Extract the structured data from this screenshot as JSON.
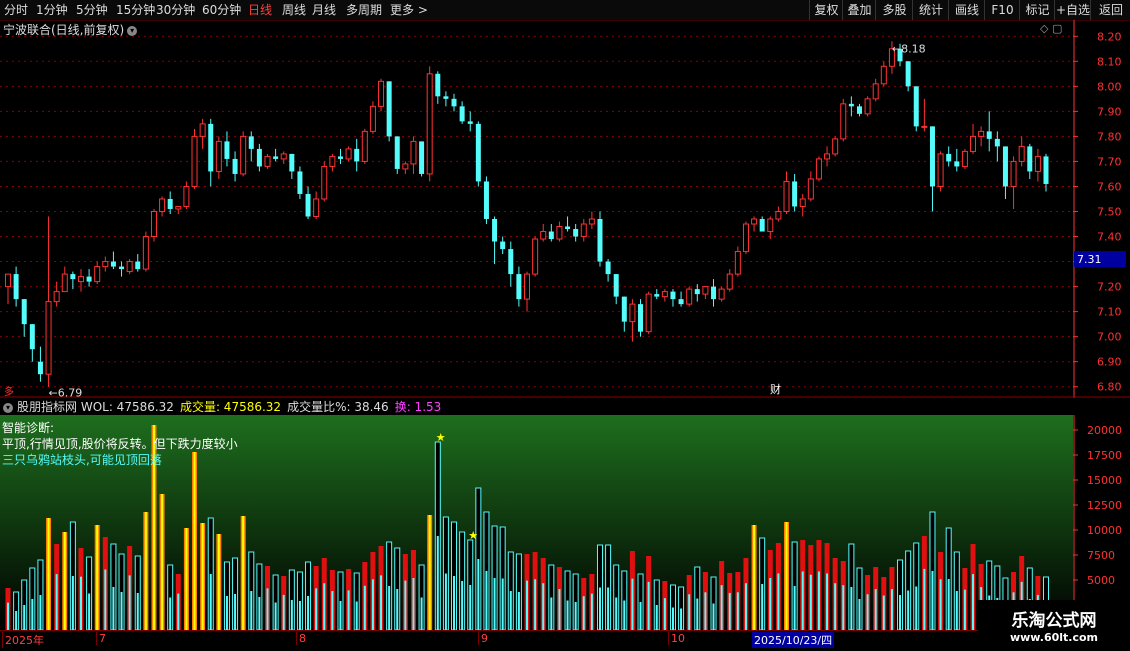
{
  "toolbar": {
    "periods": [
      {
        "label": "分时",
        "active": false
      },
      {
        "label": "1分钟",
        "active": false
      },
      {
        "label": "5分钟",
        "active": false
      },
      {
        "label": "15分钟",
        "active": false
      },
      {
        "label": "30分钟",
        "active": false
      },
      {
        "label": "60分钟",
        "active": false
      },
      {
        "label": "日线",
        "active": true
      },
      {
        "label": "周线",
        "active": false
      },
      {
        "label": "月线",
        "active": false
      },
      {
        "label": "多周期",
        "active": false
      },
      {
        "label": "更多 >",
        "active": false
      }
    ],
    "right_buttons": [
      "复权",
      "叠加",
      "多股",
      "统计",
      "画线",
      "F10",
      "标记",
      "+自选",
      "返回"
    ]
  },
  "chart_header": {
    "title": "宁波联合(日线,前复权)"
  },
  "colors": {
    "up": "#ff3232",
    "down": "#54fcfc",
    "grid": "#8b0000",
    "axis": "#ff3232",
    "yellow": "#ffff00",
    "volume_bg_top": "#000000",
    "volume_bg_bottom": "#1e6e1e"
  },
  "price_axis": {
    "ticks": [
      "8.20",
      "8.10",
      "8.00",
      "7.90",
      "7.80",
      "7.70",
      "7.60",
      "7.50",
      "7.40",
      "7.30",
      "7.20",
      "7.10",
      "7.00",
      "6.90",
      "6.80"
    ],
    "current_price": "7.31",
    "high_label": "8.18",
    "low_label": "6.79"
  },
  "markers": {
    "finance": "财",
    "corner": "多"
  },
  "indicator": {
    "name": "股朋指标网",
    "items": [
      {
        "label": "WOL:",
        "value": "47586.32",
        "color": "#dddddd"
      },
      {
        "label": "成交量:",
        "value": "47586.32",
        "color": "#ffff00"
      },
      {
        "label": "成交量比%:",
        "value": "38.46",
        "color": "#dddddd"
      },
      {
        "label": "换:",
        "value": "1.53",
        "color": "#ff40ff"
      }
    ],
    "diagnosis": {
      "title": "智能诊断:",
      "line1": "平顶,行情见顶,股价将反转。但下跌力度较小",
      "line2": "三只乌鸦站枝头,可能见顶回落"
    },
    "axis_ticks": [
      "20000",
      "17500",
      "15000",
      "12500",
      "10000",
      "7500",
      "5000"
    ]
  },
  "time_axis": {
    "labels": [
      "2025年",
      "7",
      "8",
      "9",
      "10",
      "2025/10/23/四"
    ]
  },
  "watermark": {
    "line1": "乐淘公式网",
    "line2": "www.60lt.com"
  },
  "chart_data": {
    "type": "candlestick",
    "y_range": [
      6.79,
      8.18
    ],
    "vol_range": [
      0,
      21000
    ],
    "candles": [
      [
        7.2,
        7.25,
        7.13,
        7.25,
        4200
      ],
      [
        7.25,
        7.28,
        7.12,
        7.15,
        3800
      ],
      [
        7.15,
        7.15,
        7.0,
        7.05,
        5000
      ],
      [
        7.05,
        7.05,
        6.9,
        6.95,
        6200
      ],
      [
        6.9,
        6.96,
        6.82,
        6.85,
        7000
      ],
      [
        6.85,
        7.48,
        6.8,
        7.14,
        11200
      ],
      [
        7.14,
        7.22,
        7.12,
        7.18,
        8600
      ],
      [
        7.18,
        7.28,
        7.18,
        7.25,
        9800
      ],
      [
        7.25,
        7.26,
        7.19,
        7.23,
        10800
      ],
      [
        7.22,
        7.27,
        7.18,
        7.24,
        8200
      ],
      [
        7.24,
        7.27,
        7.2,
        7.22,
        7300
      ],
      [
        7.22,
        7.3,
        7.21,
        7.28,
        10500
      ],
      [
        7.28,
        7.32,
        7.26,
        7.3,
        9300
      ],
      [
        7.3,
        7.34,
        7.27,
        7.28,
        8600
      ],
      [
        7.28,
        7.3,
        7.24,
        7.27,
        7600
      ],
      [
        7.26,
        7.31,
        7.25,
        7.3,
        8400
      ],
      [
        7.3,
        7.33,
        7.26,
        7.27,
        7400
      ],
      [
        7.27,
        7.42,
        7.26,
        7.4,
        11800
      ],
      [
        7.4,
        7.51,
        7.38,
        7.5,
        20500
      ],
      [
        7.5,
        7.56,
        7.48,
        7.55,
        13600
      ],
      [
        7.55,
        7.58,
        7.49,
        7.51,
        6500
      ],
      [
        7.51,
        7.52,
        7.49,
        7.52,
        5600
      ],
      [
        7.52,
        7.62,
        7.51,
        7.6,
        10200
      ],
      [
        7.6,
        7.83,
        7.59,
        7.8,
        17800
      ],
      [
        7.8,
        7.87,
        7.75,
        7.85,
        10700
      ],
      [
        7.85,
        7.87,
        7.6,
        7.66,
        11200
      ],
      [
        7.66,
        7.8,
        7.63,
        7.78,
        9600
      ],
      [
        7.78,
        7.82,
        7.68,
        7.71,
        6800
      ],
      [
        7.71,
        7.74,
        7.62,
        7.65,
        7200
      ],
      [
        7.65,
        7.82,
        7.64,
        7.8,
        11400
      ],
      [
        7.8,
        7.82,
        7.7,
        7.75,
        7800
      ],
      [
        7.75,
        7.77,
        7.66,
        7.68,
        6600
      ],
      [
        7.68,
        7.73,
        7.67,
        7.72,
        6400
      ],
      [
        7.72,
        7.75,
        7.7,
        7.71,
        5500
      ],
      [
        7.71,
        7.74,
        7.69,
        7.73,
        5400
      ],
      [
        7.73,
        7.73,
        7.63,
        7.66,
        6000
      ],
      [
        7.66,
        7.68,
        7.55,
        7.57,
        5800
      ],
      [
        7.57,
        7.6,
        7.47,
        7.48,
        6800
      ],
      [
        7.48,
        7.58,
        7.47,
        7.55,
        6400
      ],
      [
        7.55,
        7.7,
        7.54,
        7.68,
        7200
      ],
      [
        7.68,
        7.73,
        7.66,
        7.72,
        6000
      ],
      [
        7.72,
        7.75,
        7.69,
        7.71,
        5800
      ],
      [
        7.71,
        7.76,
        7.7,
        7.75,
        6100
      ],
      [
        7.75,
        7.79,
        7.66,
        7.7,
        5700
      ],
      [
        7.7,
        7.83,
        7.69,
        7.82,
        6800
      ],
      [
        7.82,
        7.94,
        7.81,
        7.92,
        7800
      ],
      [
        7.92,
        8.03,
        7.9,
        8.02,
        8400
      ],
      [
        8.02,
        8.02,
        7.78,
        7.8,
        8800
      ],
      [
        7.8,
        7.8,
        7.65,
        7.67,
        8200
      ],
      [
        7.67,
        7.7,
        7.65,
        7.69,
        7600
      ],
      [
        7.69,
        7.8,
        7.65,
        7.78,
        8000
      ],
      [
        7.78,
        7.78,
        7.64,
        7.65,
        6500
      ],
      [
        7.65,
        8.08,
        7.62,
        8.05,
        11500
      ],
      [
        8.05,
        8.06,
        7.93,
        7.96,
        18800
      ],
      [
        7.96,
        7.98,
        7.92,
        7.95,
        11300
      ],
      [
        7.95,
        7.97,
        7.9,
        7.92,
        10800
      ],
      [
        7.92,
        7.94,
        7.85,
        7.86,
        9800
      ],
      [
        7.86,
        7.9,
        7.82,
        7.85,
        9000
      ],
      [
        7.85,
        7.86,
        7.6,
        7.62,
        14200
      ],
      [
        7.62,
        7.64,
        7.45,
        7.47,
        11800
      ],
      [
        7.47,
        7.48,
        7.29,
        7.38,
        10400
      ],
      [
        7.38,
        7.4,
        7.33,
        7.35,
        10300
      ],
      [
        7.35,
        7.38,
        7.2,
        7.25,
        7800
      ],
      [
        7.25,
        7.28,
        7.12,
        7.15,
        7600
      ],
      [
        7.15,
        7.26,
        7.1,
        7.25,
        7600
      ],
      [
        7.25,
        7.4,
        7.24,
        7.39,
        7800
      ],
      [
        7.39,
        7.45,
        7.38,
        7.42,
        7200
      ],
      [
        7.42,
        7.45,
        7.38,
        7.39,
        6500
      ],
      [
        7.39,
        7.46,
        7.38,
        7.44,
        6300
      ],
      [
        7.44,
        7.48,
        7.42,
        7.43,
        5900
      ],
      [
        7.43,
        7.45,
        7.38,
        7.4,
        5600
      ],
      [
        7.4,
        7.47,
        7.38,
        7.45,
        5200
      ],
      [
        7.45,
        7.5,
        7.43,
        7.47,
        5600
      ],
      [
        7.47,
        7.5,
        7.28,
        7.3,
        8500
      ],
      [
        7.3,
        7.31,
        7.22,
        7.25,
        8500
      ],
      [
        7.25,
        7.25,
        7.13,
        7.16,
        6500
      ],
      [
        7.16,
        7.16,
        7.02,
        7.06,
        5900
      ],
      [
        7.06,
        7.15,
        6.98,
        7.13,
        7900
      ],
      [
        7.13,
        7.15,
        7.0,
        7.02,
        5600
      ],
      [
        7.02,
        7.18,
        7.01,
        7.17,
        7400
      ],
      [
        7.17,
        7.19,
        7.15,
        7.16,
        5000
      ],
      [
        7.16,
        7.19,
        7.14,
        7.18,
        4900
      ],
      [
        7.18,
        7.19,
        7.12,
        7.15,
        4500
      ],
      [
        7.15,
        7.18,
        7.12,
        7.13,
        4300
      ],
      [
        7.13,
        7.2,
        7.12,
        7.19,
        5500
      ],
      [
        7.19,
        7.21,
        7.14,
        7.17,
        6300
      ],
      [
        7.17,
        7.2,
        7.15,
        7.2,
        5800
      ],
      [
        7.2,
        7.23,
        7.12,
        7.15,
        5300
      ],
      [
        7.15,
        7.2,
        7.14,
        7.19,
        6900
      ],
      [
        7.19,
        7.27,
        7.18,
        7.25,
        5700
      ],
      [
        7.25,
        7.36,
        7.24,
        7.34,
        5800
      ],
      [
        7.34,
        7.46,
        7.33,
        7.45,
        7200
      ],
      [
        7.45,
        7.48,
        7.42,
        7.47,
        10500
      ],
      [
        7.47,
        7.48,
        7.42,
        7.42,
        9200
      ],
      [
        7.42,
        7.48,
        7.39,
        7.47,
        8000
      ],
      [
        7.47,
        7.52,
        7.46,
        7.5,
        8700
      ],
      [
        7.5,
        7.66,
        7.49,
        7.62,
        10800
      ],
      [
        7.62,
        7.65,
        7.5,
        7.52,
        8800
      ],
      [
        7.52,
        7.57,
        7.48,
        7.55,
        9000
      ],
      [
        7.55,
        7.66,
        7.54,
        7.63,
        8500
      ],
      [
        7.63,
        7.72,
        7.62,
        7.71,
        9000
      ],
      [
        7.71,
        7.76,
        7.68,
        7.73,
        8700
      ],
      [
        7.73,
        7.8,
        7.72,
        7.79,
        7200
      ],
      [
        7.79,
        7.95,
        7.78,
        7.93,
        6900
      ],
      [
        7.93,
        7.96,
        7.88,
        7.92,
        8600
      ],
      [
        7.92,
        7.93,
        7.88,
        7.89,
        6200
      ],
      [
        7.89,
        7.96,
        7.88,
        7.95,
        5500
      ],
      [
        7.95,
        8.03,
        7.94,
        8.01,
        6300
      ],
      [
        8.01,
        8.1,
        8.0,
        8.08,
        5300
      ],
      [
        8.08,
        8.18,
        8.05,
        8.15,
        6300
      ],
      [
        8.15,
        8.17,
        8.08,
        8.1,
        7000
      ],
      [
        8.1,
        8.1,
        7.98,
        8.0,
        7900
      ],
      [
        8.0,
        8.0,
        7.82,
        7.84,
        8700
      ],
      [
        7.84,
        7.95,
        7.82,
        7.84,
        9400
      ],
      [
        7.84,
        7.84,
        7.5,
        7.6,
        11800
      ],
      [
        7.6,
        7.74,
        7.58,
        7.73,
        7800
      ],
      [
        7.73,
        7.76,
        7.68,
        7.7,
        10200
      ],
      [
        7.7,
        7.75,
        7.66,
        7.68,
        7800
      ],
      [
        7.68,
        7.75,
        7.67,
        7.74,
        6200
      ],
      [
        7.74,
        7.85,
        7.73,
        7.8,
        8600
      ],
      [
        7.8,
        7.84,
        7.76,
        7.82,
        6600
      ],
      [
        7.82,
        7.9,
        7.74,
        7.79,
        6900
      ],
      [
        7.79,
        7.82,
        7.7,
        7.76,
        6400
      ],
      [
        7.76,
        7.76,
        7.55,
        7.6,
        5200
      ],
      [
        7.6,
        7.72,
        7.51,
        7.7,
        5800
      ],
      [
        7.7,
        7.8,
        7.68,
        7.76,
        7400
      ],
      [
        7.76,
        7.77,
        7.63,
        7.66,
        6200
      ],
      [
        7.66,
        7.75,
        7.62,
        7.72,
        5400
      ],
      [
        7.72,
        7.73,
        7.58,
        7.61,
        5300
      ]
    ]
  }
}
